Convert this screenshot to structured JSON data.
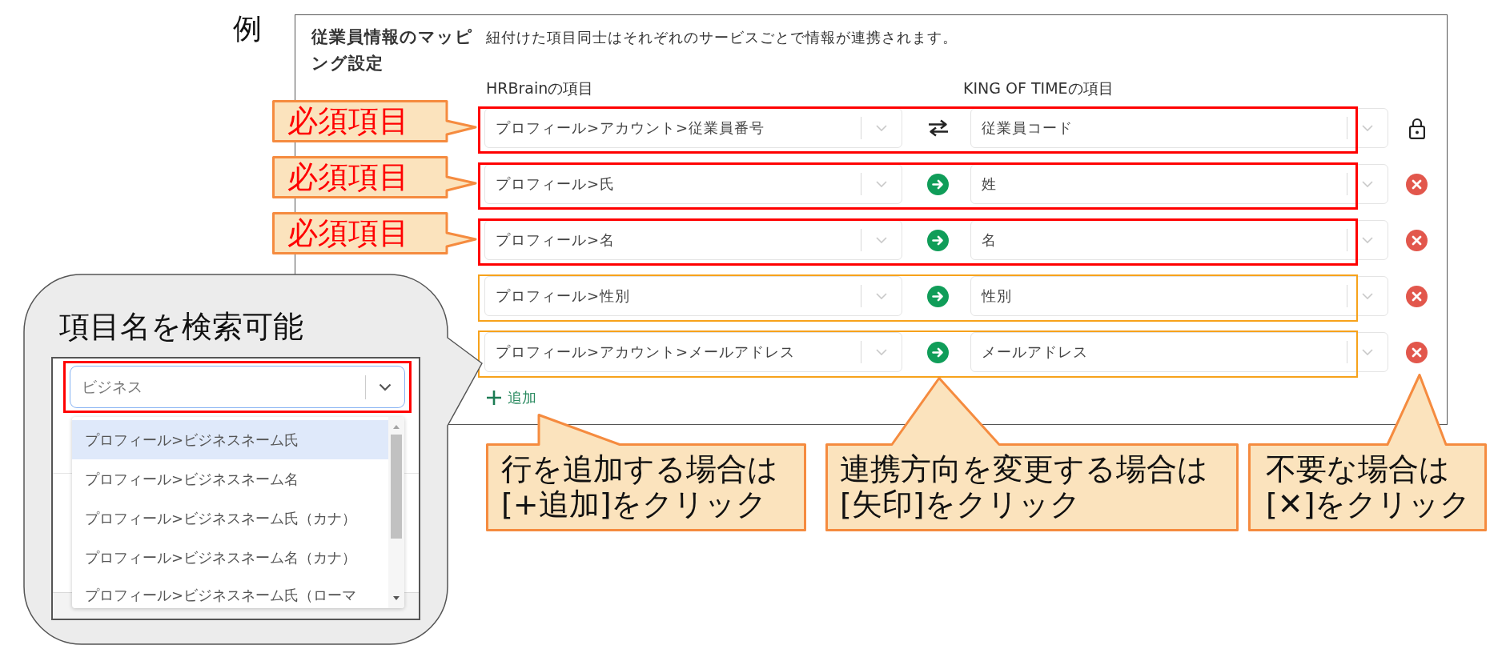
{
  "example_label": "例",
  "panel": {
    "title": "従業員情報のマッピング設定",
    "description": "紐付けた項目同士はそれぞれのサービスごとで情報が連携されます。",
    "columns": [
      "HRBrainの項目",
      "KING OF TIMEの項目"
    ],
    "rows": [
      {
        "source": "プロフィール>アカウント>従業員番号",
        "two_way": true,
        "target": "従業員コード",
        "locked": true,
        "tag": "必須項目",
        "color": "#ff0000"
      },
      {
        "source": "プロフィール>氏",
        "two_way": false,
        "target": "姓",
        "locked": false,
        "tag": "必須項目",
        "color": "#ff0000"
      },
      {
        "source": "プロフィール>名",
        "two_way": false,
        "target": "名",
        "locked": false,
        "tag": "必須項目",
        "color": "#ff0000"
      },
      {
        "source": "プロフィール>性別",
        "two_way": false,
        "target": "性別",
        "locked": false,
        "color": "#f7a21b"
      },
      {
        "source": "プロフィール>アカウント>メールアドレス",
        "two_way": false,
        "target": "メールアドレス",
        "locked": false,
        "color": "#f7a21b"
      }
    ],
    "add_button": "追加"
  },
  "search_callout": {
    "title": "項目名を検索可能",
    "search": {
      "value": "ビジネス"
    },
    "options": [
      {
        "label": "プロフィール>ビジネスネーム氏",
        "selected": true
      },
      {
        "label": "プロフィール>ビジネスネーム名",
        "selected": false
      },
      {
        "label": "プロフィール>ビジネスネーム氏（カナ）",
        "selected": false
      },
      {
        "label": "プロフィール>ビジネスネーム名（カナ）",
        "selected": false
      },
      {
        "label": "プロフィール>ビジネスネーム氏（ローマ",
        "selected": false
      }
    ]
  },
  "notes": [
    {
      "text": "行を追加する場合は\n[+追加]をクリック"
    },
    {
      "text": "連携方向を変更する場合は\n[矢印]をクリック"
    },
    {
      "text": "不要な場合は\n[**✕**]をクリック"
    }
  ]
}
